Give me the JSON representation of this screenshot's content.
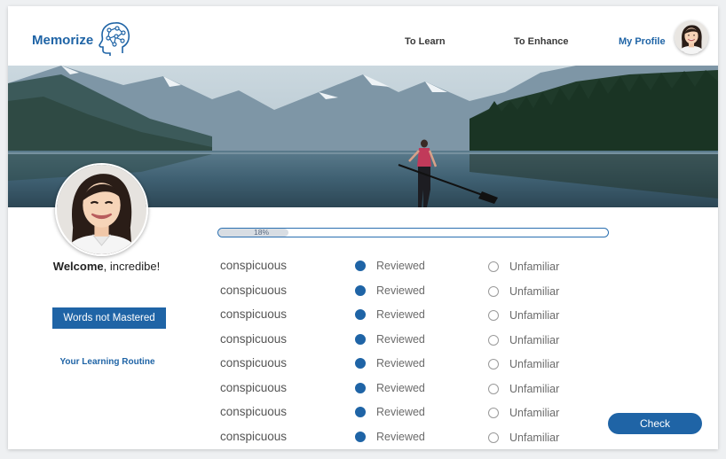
{
  "app": {
    "name": "Memorize"
  },
  "nav": {
    "to_learn": "To Learn",
    "to_enhance": "To Enhance",
    "my_profile": "My Profile"
  },
  "colors": {
    "accent": "#1f64a6",
    "progress_fill": "#d8dde3"
  },
  "sidebar": {
    "welcome_prefix": "Welcome",
    "welcome_suffix": ", incredibe!",
    "words_not_mastered": "Words not Mastered",
    "learning_routine": "Your Learning Routine"
  },
  "progress": {
    "percent": 18,
    "label": "18%"
  },
  "words": [
    {
      "word": "conspicuous",
      "reviewed": "Reviewed",
      "unfamiliar": "Unfamiliar",
      "selected": "reviewed"
    },
    {
      "word": "conspicuous",
      "reviewed": "Reviewed",
      "unfamiliar": "Unfamiliar",
      "selected": "reviewed"
    },
    {
      "word": "conspicuous",
      "reviewed": "Reviewed",
      "unfamiliar": "Unfamiliar",
      "selected": "reviewed"
    },
    {
      "word": "conspicuous",
      "reviewed": "Reviewed",
      "unfamiliar": "Unfamiliar",
      "selected": "reviewed"
    },
    {
      "word": "conspicuous",
      "reviewed": "Reviewed",
      "unfamiliar": "Unfamiliar",
      "selected": "reviewed"
    },
    {
      "word": "conspicuous",
      "reviewed": "Reviewed",
      "unfamiliar": "Unfamiliar",
      "selected": "reviewed"
    },
    {
      "word": "conspicuous",
      "reviewed": "Reviewed",
      "unfamiliar": "Unfamiliar",
      "selected": "reviewed"
    },
    {
      "word": "conspicuous",
      "reviewed": "Reviewed",
      "unfamiliar": "Unfamiliar",
      "selected": "reviewed"
    }
  ],
  "check_button": "Check",
  "icons": {
    "logo": "brain-head-icon",
    "avatar": "avatar-photo"
  }
}
